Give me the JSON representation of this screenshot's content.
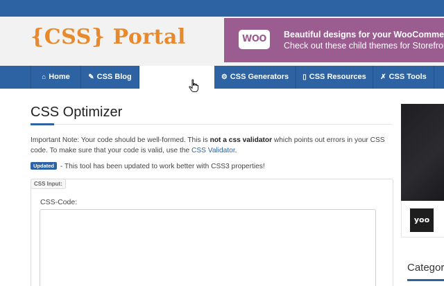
{
  "header": {
    "logo_text": "{CSS} Portal"
  },
  "ad": {
    "brand_logo": "WOO",
    "line1": "Beautiful designs for your WooCommerce",
    "line2": "Check out these child themes for Storefront"
  },
  "nav": {
    "items": [
      {
        "label": "Home",
        "icon": "home-icon"
      },
      {
        "label": "CSS Blog",
        "icon": "pencil-icon"
      },
      {
        "label": "CSS Generators",
        "icon": "gear-icon"
      },
      {
        "label": "CSS Resources",
        "icon": "file-icon"
      },
      {
        "label": "CSS Tools",
        "icon": "wrench-icon"
      }
    ]
  },
  "main": {
    "title": "CSS Optimizer",
    "note_prefix": "Important Note: Your code should be well-formed. This is ",
    "note_bold": "not a css validator",
    "note_mid": " which points out errors in your CSS code. To make sure that your code is valid, use the ",
    "note_link": "CSS Validator",
    "note_suffix": ".",
    "badge": "Updated",
    "update_text": " - This tool has been updated to work better with CSS3 properties!",
    "panel_tag": "CSS Input:",
    "field_label": "CSS-Code:"
  },
  "sidebar": {
    "card_logo": "yoo",
    "section_title": "Categori"
  },
  "colors": {
    "brand_blue": "#2d62a3",
    "logo_orange": "#e88a2c",
    "woo_purple": "#9b5c8f"
  }
}
